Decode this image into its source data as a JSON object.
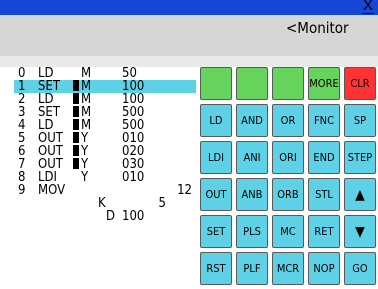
{
  "window": {
    "close_label": "X"
  },
  "header": {
    "title": "<Monitor"
  },
  "program": [
    {
      "step": "0",
      "inst": "LD",
      "bar": false,
      "dev": "M",
      "val": "50",
      "selected": false
    },
    {
      "step": "1",
      "inst": "SET",
      "bar": true,
      "dev": "M",
      "val": "100",
      "selected": true
    },
    {
      "step": "2",
      "inst": "LD",
      "bar": true,
      "dev": "M",
      "val": "100",
      "selected": false
    },
    {
      "step": "3",
      "inst": "SET",
      "bar": true,
      "dev": "M",
      "val": "500",
      "selected": false
    },
    {
      "step": "4",
      "inst": "LD",
      "bar": true,
      "dev": "M",
      "val": "500",
      "selected": false
    },
    {
      "step": "5",
      "inst": "OUT",
      "bar": true,
      "dev": "Y",
      "val": "010",
      "selected": false
    },
    {
      "step": "6",
      "inst": "OUT",
      "bar": true,
      "dev": "Y",
      "val": "020",
      "selected": false
    },
    {
      "step": "7",
      "inst": "OUT",
      "bar": true,
      "dev": "Y",
      "val": "030",
      "selected": false
    },
    {
      "step": "8",
      "inst": "LDI",
      "bar": false,
      "dev": "Y",
      "val": "010",
      "selected": false
    },
    {
      "step": "9",
      "inst": "MOV",
      "bar": false,
      "dev": "",
      "val": "12",
      "selected": false
    },
    {
      "step": "",
      "inst": "",
      "bar": false,
      "dev": "K",
      "val": "5",
      "selected": false
    },
    {
      "step": "",
      "inst": "",
      "bar": false,
      "dev": "D",
      "val": "100",
      "selected": false
    }
  ],
  "keypad": [
    [
      "",
      "",
      "",
      "MORE",
      "CLR"
    ],
    [
      "LD",
      "AND",
      "OR",
      "FNC",
      "SP"
    ],
    [
      "LDI",
      "ANI",
      "ORI",
      "END",
      "STEP"
    ],
    [
      "OUT",
      "ANB",
      "ORB",
      "STL",
      "▲"
    ],
    [
      "SET",
      "PLS",
      "MC",
      "RET",
      "▼"
    ],
    [
      "RST",
      "PLF",
      "MCR",
      "NOP",
      "GO"
    ]
  ],
  "colors": {
    "title_bar": "#1546d6",
    "key_green": "#66d45c",
    "key_cyan": "#5fd1e6",
    "key_red": "#ff3333",
    "selection": "#5fd1e6"
  }
}
